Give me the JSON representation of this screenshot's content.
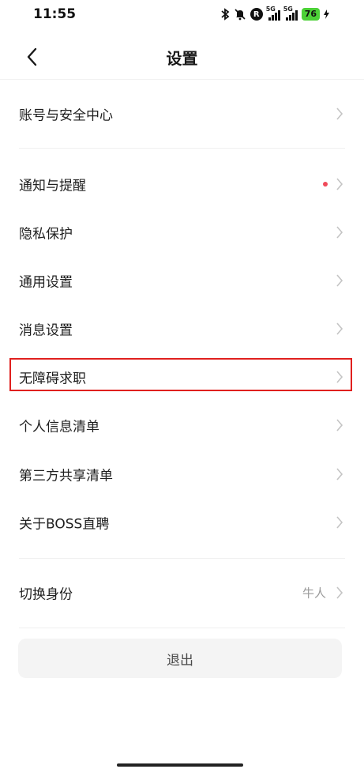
{
  "status_bar": {
    "time": "11:55",
    "network_tag_1": "5G",
    "network_tag_2": "5G",
    "r_badge": "R",
    "battery": "76"
  },
  "nav": {
    "title": "设置",
    "back_icon": "chevron-left-icon"
  },
  "groups": {
    "account": {
      "label": "账号与安全中心"
    },
    "notify": {
      "label": "通知与提醒",
      "has_red_dot": true
    },
    "privacy": {
      "label": "隐私保护"
    },
    "general": {
      "label": "通用设置"
    },
    "message": {
      "label": "消息设置"
    },
    "accessible": {
      "label": "无障碍求职"
    },
    "personal_list": {
      "label": "个人信息清单"
    },
    "third_party": {
      "label": "第三方共享清单"
    },
    "about": {
      "label": "关于BOSS直聘"
    },
    "switch_identity": {
      "label": "切换身份",
      "value": "牛人"
    }
  },
  "logout": {
    "label": "退出"
  },
  "colors": {
    "accent_red": "#e0201e",
    "dot_red": "#f04a5a",
    "chevron": "#c4c4c4"
  }
}
